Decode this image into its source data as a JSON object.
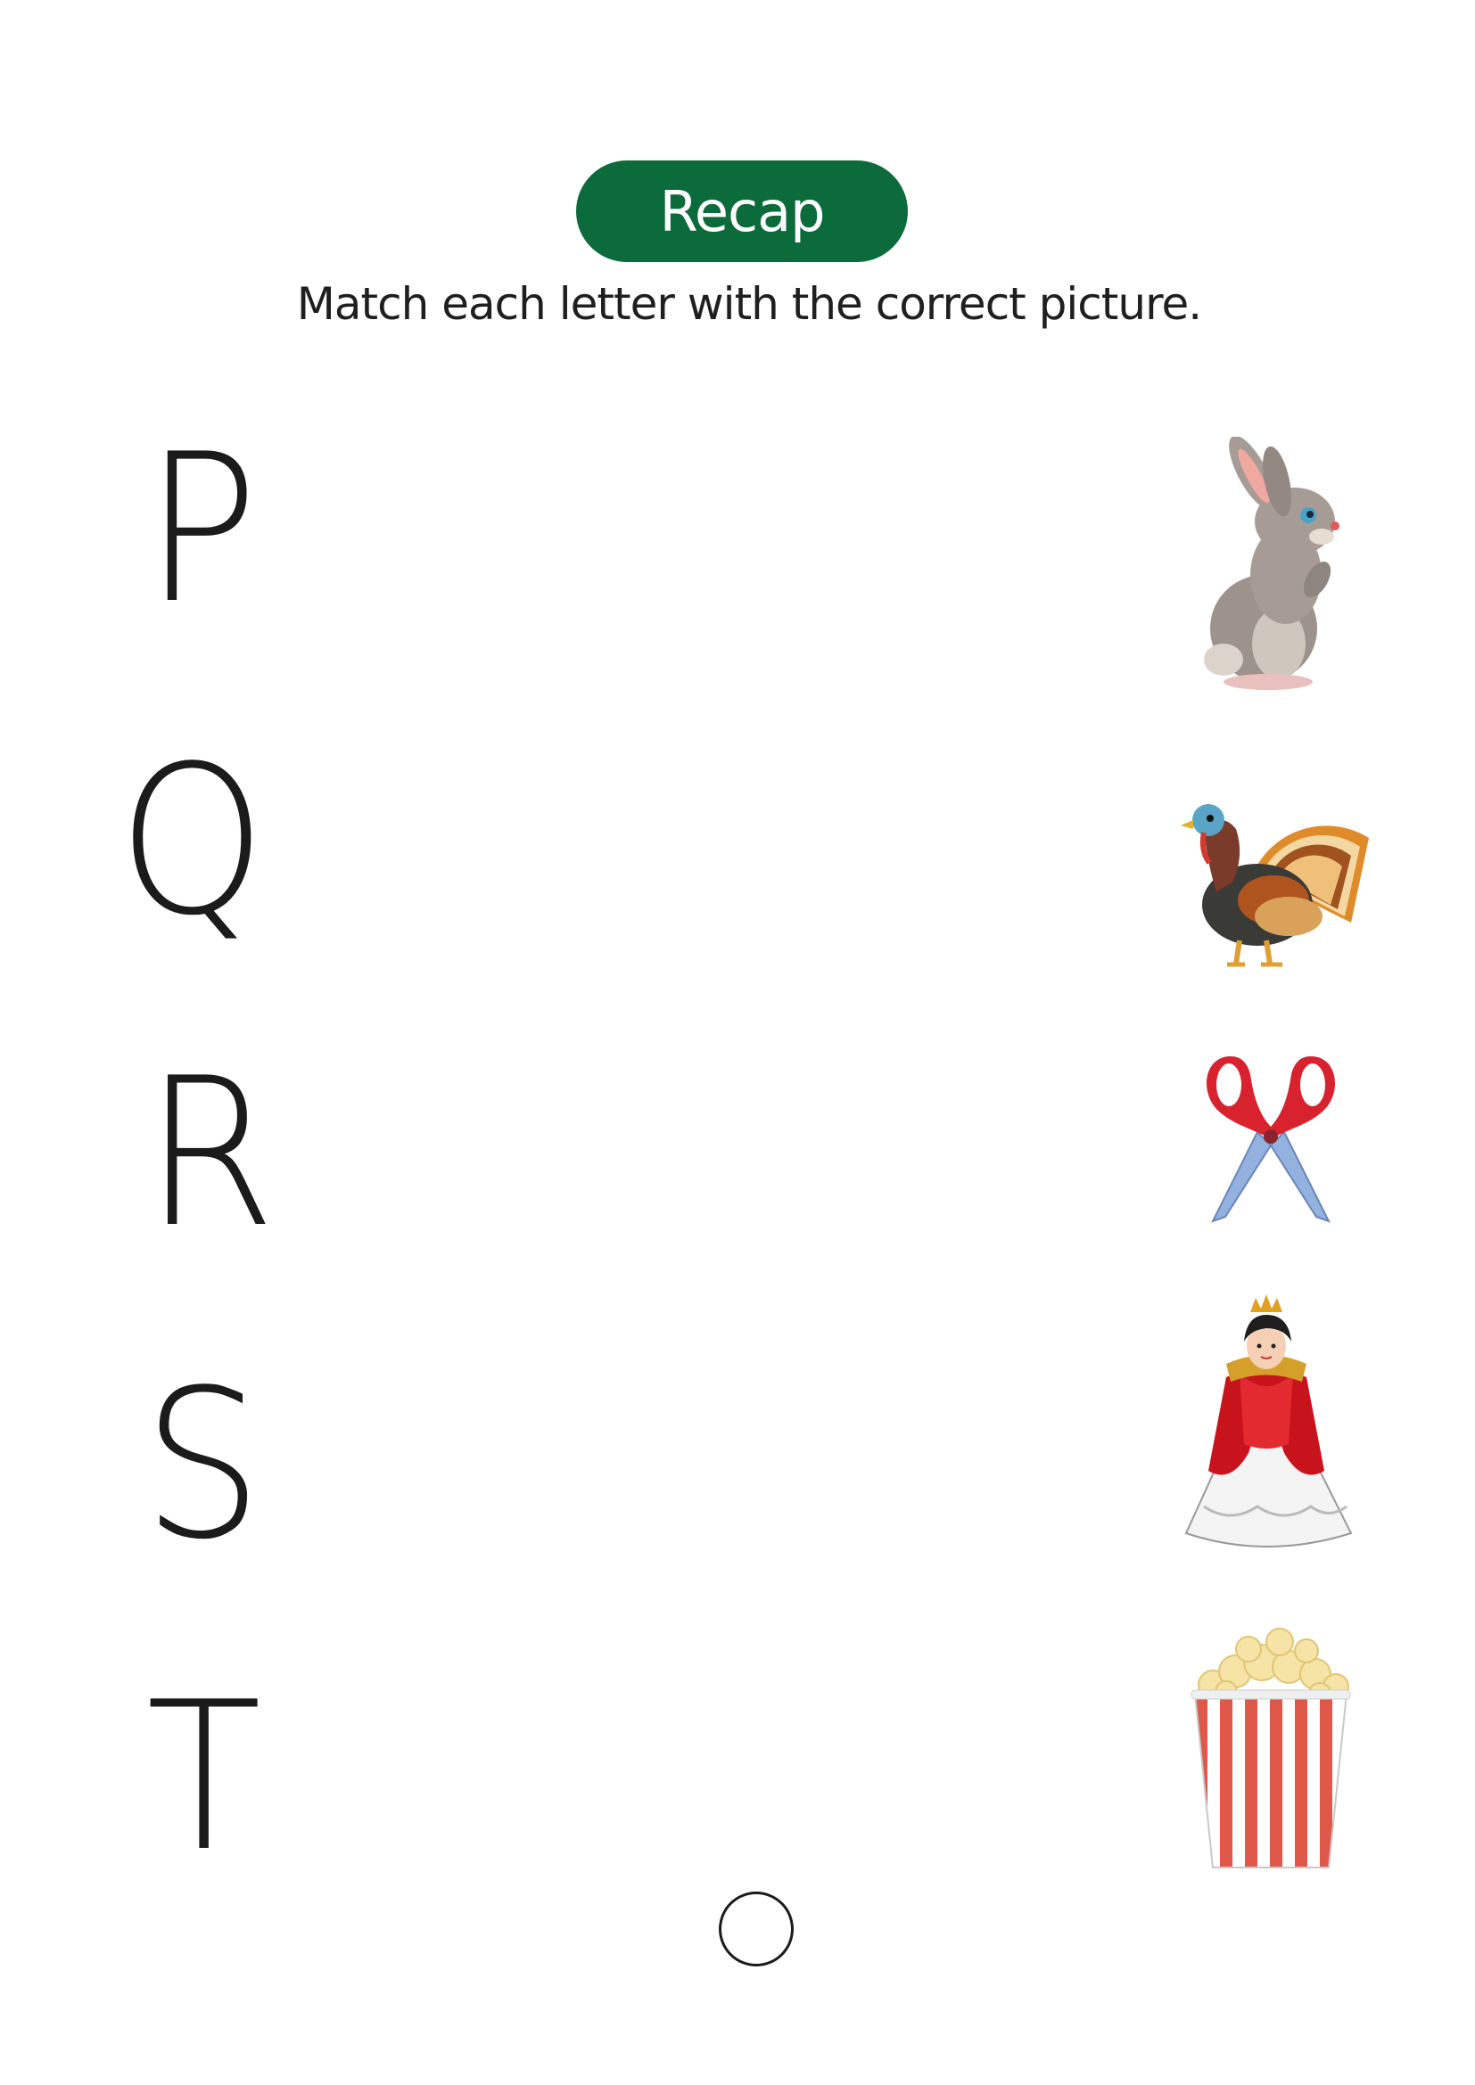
{
  "header": {
    "title": "Recap",
    "instruction": "Match each letter with the correct picture."
  },
  "letters": [
    "P",
    "Q",
    "R",
    "S",
    "T"
  ],
  "pictures": [
    {
      "icon": "rabbit-icon"
    },
    {
      "icon": "turkey-icon"
    },
    {
      "icon": "scissors-icon"
    },
    {
      "icon": "queen-icon"
    },
    {
      "icon": "popcorn-icon"
    }
  ],
  "colors": {
    "accent": "#0b6b3a"
  }
}
